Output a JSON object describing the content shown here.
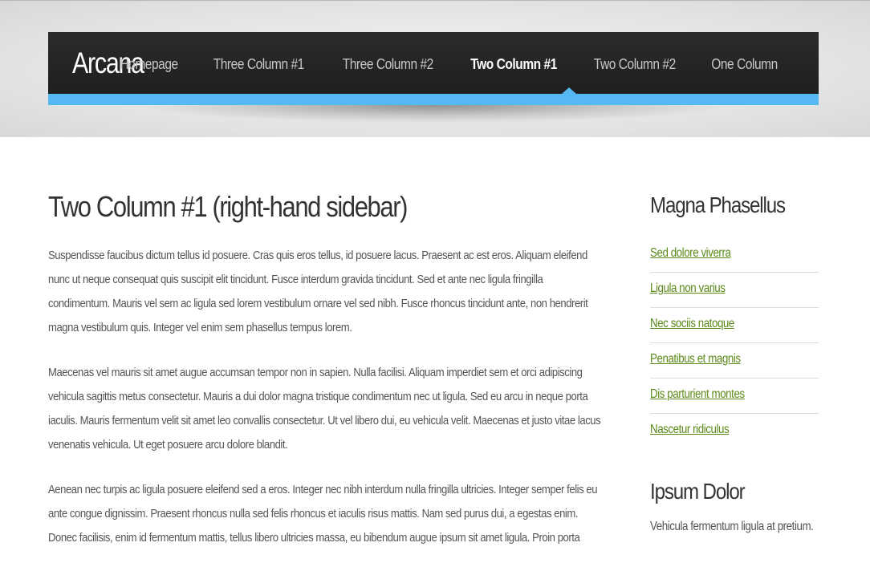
{
  "site": {
    "logo": "Arcana"
  },
  "nav": {
    "items": [
      {
        "label": "Homepage",
        "active": false
      },
      {
        "label": "Three Column #1",
        "active": false
      },
      {
        "label": "Three Column #2",
        "active": false
      },
      {
        "label": "Two Column #1",
        "active": true
      },
      {
        "label": "Two Column #2",
        "active": false
      },
      {
        "label": "One Column",
        "active": false
      }
    ]
  },
  "main": {
    "title": "Two Column #1 (right-hand sidebar)",
    "paragraphs": [
      "Suspendisse faucibus dictum tellus id posuere. Cras quis eros tellus, id posuere lacus. Praesent ac est eros. Aliquam eleifend nunc ut neque consequat quis suscipit elit tincidunt. Fusce interdum gravida tincidunt. Sed et ante nec ligula fringilla condimentum. Mauris vel sem ac ligula sed lorem vestibulum ornare vel sed nibh. Fusce rhoncus tincidunt ante, non hendrerit magna vestibulum quis. Integer vel enim sem phasellus tempus lorem.",
      "Maecenas vel mauris sit amet augue accumsan tempor non in sapien. Nulla facilisi. Aliquam imperdiet sem et orci adipiscing vehicula sagittis metus consectetur. Mauris a dui dolor magna tristique condimentum nec ut ligula. Sed eu arcu in neque porta iaculis. Mauris fermentum velit sit amet leo convallis consectetur. Ut vel libero dui, eu vehicula velit. Maecenas et justo vitae lacus venenatis vehicula. Ut eget posuere arcu dolore blandit.",
      "Aenean nec turpis ac ligula posuere eleifend sed a eros. Integer nec nibh interdum nulla fringilla ultricies. Integer semper felis eu ante congue dignissim. Praesent rhoncus nulla sed felis rhoncus et iaculis risus mattis. Nam sed purus dui, a egestas enim. Donec facilisis, enim id fermentum mattis, tellus libero ultricies massa, eu bibendum augue ipsum sit amet ligula. Proin porta"
    ]
  },
  "sidebar": {
    "heading1": "Magna Phasellus",
    "links": [
      "Sed dolore viverra",
      "Ligula non varius",
      "Nec sociis natoque",
      "Penatibus et magnis",
      "Dis parturient montes",
      "Nascetur ridiculus"
    ],
    "heading2": "Ipsum Dolor",
    "text2": "Vehicula fermentum ligula at pretium."
  },
  "colors": {
    "accent": "#56b8f3",
    "navbar": "#222222",
    "link": "#5b8a1a"
  }
}
